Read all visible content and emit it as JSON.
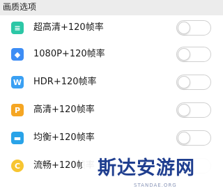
{
  "header": {
    "title": "画质选项"
  },
  "options": [
    {
      "label": "超高清+120帧率",
      "icon": "super-hd-icon",
      "glyph": "≡",
      "color": "#2cc7a6",
      "enabled": false
    },
    {
      "label": "1080P+120帧率",
      "icon": "1080p-icon",
      "glyph": "◆",
      "color": "#3d8df5",
      "enabled": false
    },
    {
      "label": "HDR+120帧率",
      "icon": "hdr-icon",
      "glyph": "W",
      "color": "#3aa0f3",
      "enabled": false
    },
    {
      "label": "高清+120帧率",
      "icon": "hd-icon",
      "glyph": "P",
      "color": "#f5a623",
      "enabled": false
    },
    {
      "label": "均衡+120帧率",
      "icon": "balanced-icon",
      "glyph": "▬",
      "color": "#29a3e8",
      "enabled": false
    },
    {
      "label": "流畅+120帧率",
      "icon": "smooth-icon",
      "glyph": "C",
      "color": "#f7c531",
      "enabled": false
    }
  ],
  "watermark": {
    "brand": "斯达安游网",
    "site": "STANDAE.ORG"
  }
}
